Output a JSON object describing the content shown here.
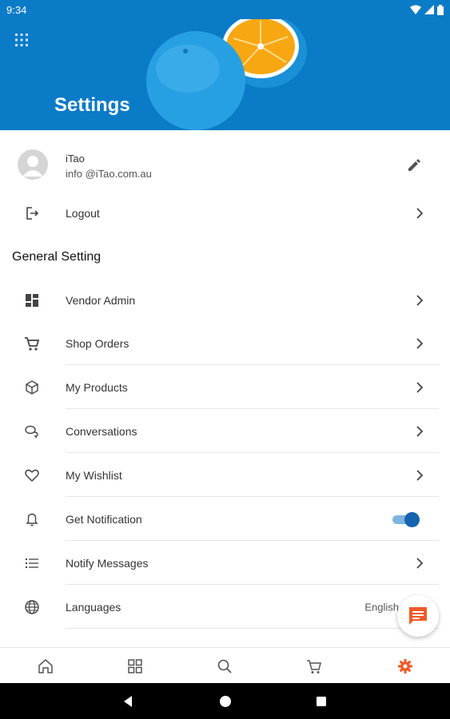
{
  "status_bar": {
    "time": "9:34"
  },
  "header": {
    "title": "Settings",
    "menu_icon": "grid-menu-icon"
  },
  "profile": {
    "name": "iTao",
    "email": "info @iTao.com.au",
    "edit_icon": "pencil-icon"
  },
  "logout": {
    "label": "Logout",
    "icon": "logout-icon"
  },
  "general_section": {
    "title": "General Setting"
  },
  "menu": {
    "vendor_admin": {
      "label": "Vendor Admin",
      "icon": "dashboard-icon"
    },
    "shop_orders": {
      "label": "Shop Orders",
      "icon": "cart-icon"
    },
    "my_products": {
      "label": "My Products",
      "icon": "box-icon"
    },
    "conversations": {
      "label": "Conversations",
      "icon": "chat-bubbles-icon"
    },
    "my_wishlist": {
      "label": "My Wishlist",
      "icon": "heart-icon"
    },
    "get_notification": {
      "label": "Get Notification",
      "icon": "bell-icon",
      "enabled": true
    },
    "notify_messages": {
      "label": "Notify Messages",
      "icon": "list-icon"
    },
    "languages": {
      "label": "Languages",
      "icon": "globe-icon",
      "value": "English"
    }
  },
  "fab": {
    "icon": "message-icon",
    "color": "#f05a28"
  },
  "bottom_nav": {
    "items": [
      "home-icon",
      "categories-icon",
      "search-icon",
      "cart-icon",
      "settings-gear-icon"
    ],
    "active": "settings-gear-icon",
    "active_color": "#f05a28"
  },
  "colors": {
    "header_blue": "#0a7bc7",
    "toggle_blue": "#1564b0"
  }
}
